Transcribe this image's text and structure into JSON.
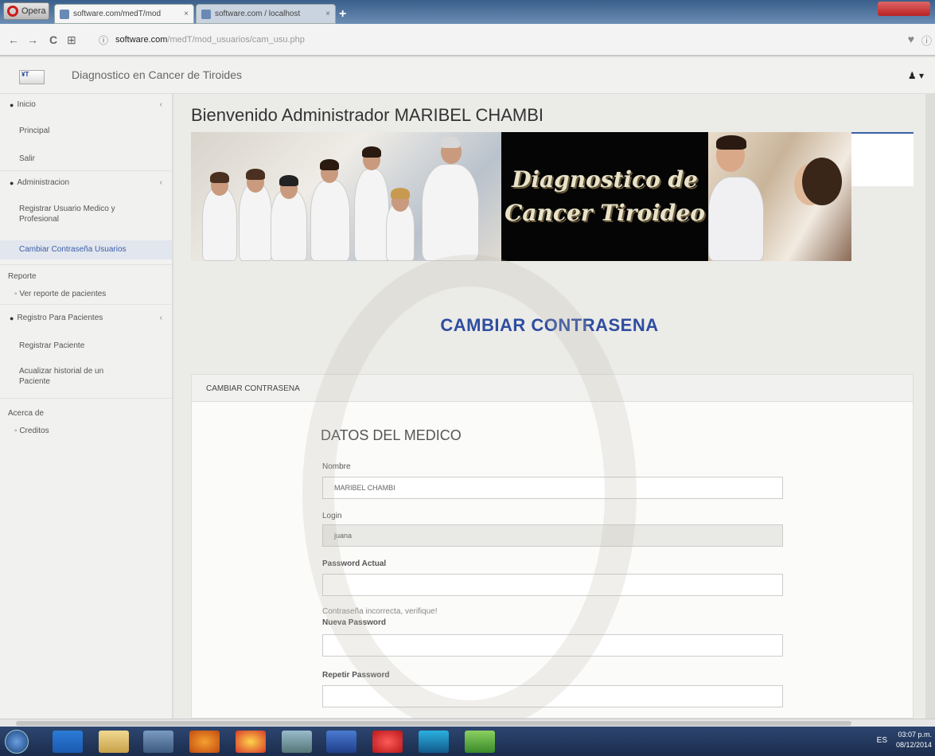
{
  "browser": {
    "menu_label": "Opera",
    "tabs": [
      {
        "label": "software.com/medT/mod",
        "close": "×"
      },
      {
        "label": "software.com / localhost",
        "close": "×"
      }
    ],
    "new_tab": "+",
    "url_domain": "software.com",
    "url_path": "/medT/mod_usuarios/cam_usu.php",
    "nav": {
      "back": "←",
      "forward": "→",
      "reload": "C",
      "grid": "⊞",
      "info": "ⓘ",
      "heart": "♥"
    }
  },
  "app": {
    "logo_text": "¥T",
    "title": "Diagnostico en Cancer de Tiroides",
    "user_icon": "♟ ▾"
  },
  "sidebar": {
    "sections": [
      {
        "label": "Inicio",
        "icon": "dashboard-icon",
        "links": [
          "Principal",
          "Salir"
        ]
      },
      {
        "label": "Administracion",
        "icon": "dashboard-icon",
        "links": [
          "Registrar Usuario Medico y Profesional",
          "Cambiar Contraseña Usuarios"
        ]
      },
      {
        "label": "Reporte",
        "sub": [
          "Ver reporte de pacientes"
        ]
      },
      {
        "label": "Registro Para Pacientes",
        "icon": "dashboard-icon",
        "links": [
          "Registrar Paciente",
          "Acualizar historial de un Paciente"
        ]
      },
      {
        "label": "Acerca de",
        "sub": [
          "Creditos"
        ]
      }
    ]
  },
  "main": {
    "welcome": "Bienvenido Administrador MARIBEL CHAMBI",
    "banner_text": [
      "Diagnostico de",
      "Cancer Tiroideo"
    ],
    "heading": "CAMBIAR CONTRASENA",
    "panel_title": "CAMBIAR CONTRASENA",
    "section_title": "DATOS DEL MEDICO",
    "fields": {
      "nombre_label": "Nombre",
      "nombre_value": "MARIBEL CHAMBI",
      "login_label": "Login",
      "login_value": "juana",
      "actual_label": "Password Actual",
      "error_text": "Contraseña incorrecta, verifique!",
      "nueva_label": "Nueva Password",
      "repetir_label": "Repetir Password"
    }
  },
  "taskbar": {
    "tray_lang": "ES",
    "time": "03:07 p.m.",
    "date": "08/12/2014"
  }
}
